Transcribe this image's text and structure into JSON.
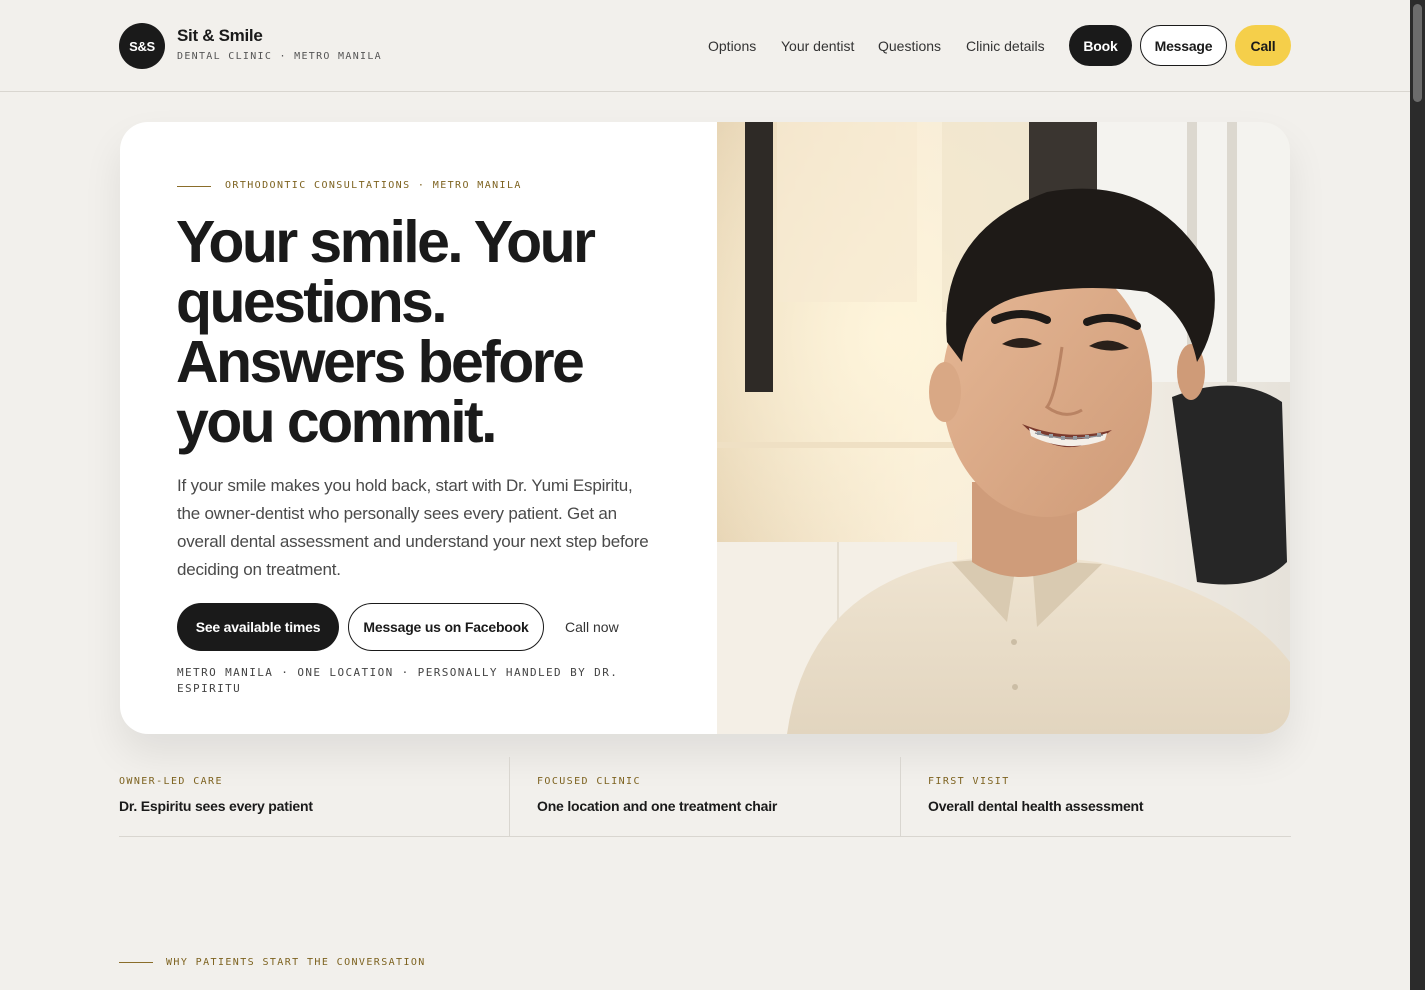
{
  "header": {
    "logo_mark": "S&S",
    "brand_name": "Sit & Smile",
    "brand_sub": "DENTAL CLINIC · METRO MANILA",
    "nav": [
      "Options",
      "Your dentist",
      "Questions",
      "Clinic details"
    ],
    "book_label": "Book",
    "message_label": "Message",
    "call_label": "Call"
  },
  "hero": {
    "eyebrow": "ORTHODONTIC CONSULTATIONS · METRO MANILA",
    "headline_main": "Your smile. Your questions. Answers before you ",
    "headline_highlight": "commit.",
    "lede": "If your smile makes you hold back, start with Dr. Yumi Espiritu, the owner-dentist who personally sees every patient. Get an overall dental assessment and understand your next step before deciding on treatment.",
    "cta_primary": "See available times",
    "cta_secondary": "Message us on Facebook",
    "cta_link": "Call now",
    "foot": "METRO MANILA · ONE LOCATION · PERSONALLY HANDLED BY DR. ESPIRITU"
  },
  "stats": [
    {
      "label": "OWNER-LED CARE",
      "value": "Dr. Espiritu sees every patient"
    },
    {
      "label": "FOCUSED CLINIC",
      "value": "One location and one treatment chair"
    },
    {
      "label": "FIRST VISIT",
      "value": "Overall dental health assessment"
    }
  ],
  "section": {
    "eyebrow": "WHY PATIENTS START THE CONVERSATION"
  },
  "colors": {
    "accent": "#f5cf4a",
    "dark": "#1a1a1a",
    "eyebrow": "#7d621f",
    "background": "#f2f0ec"
  }
}
